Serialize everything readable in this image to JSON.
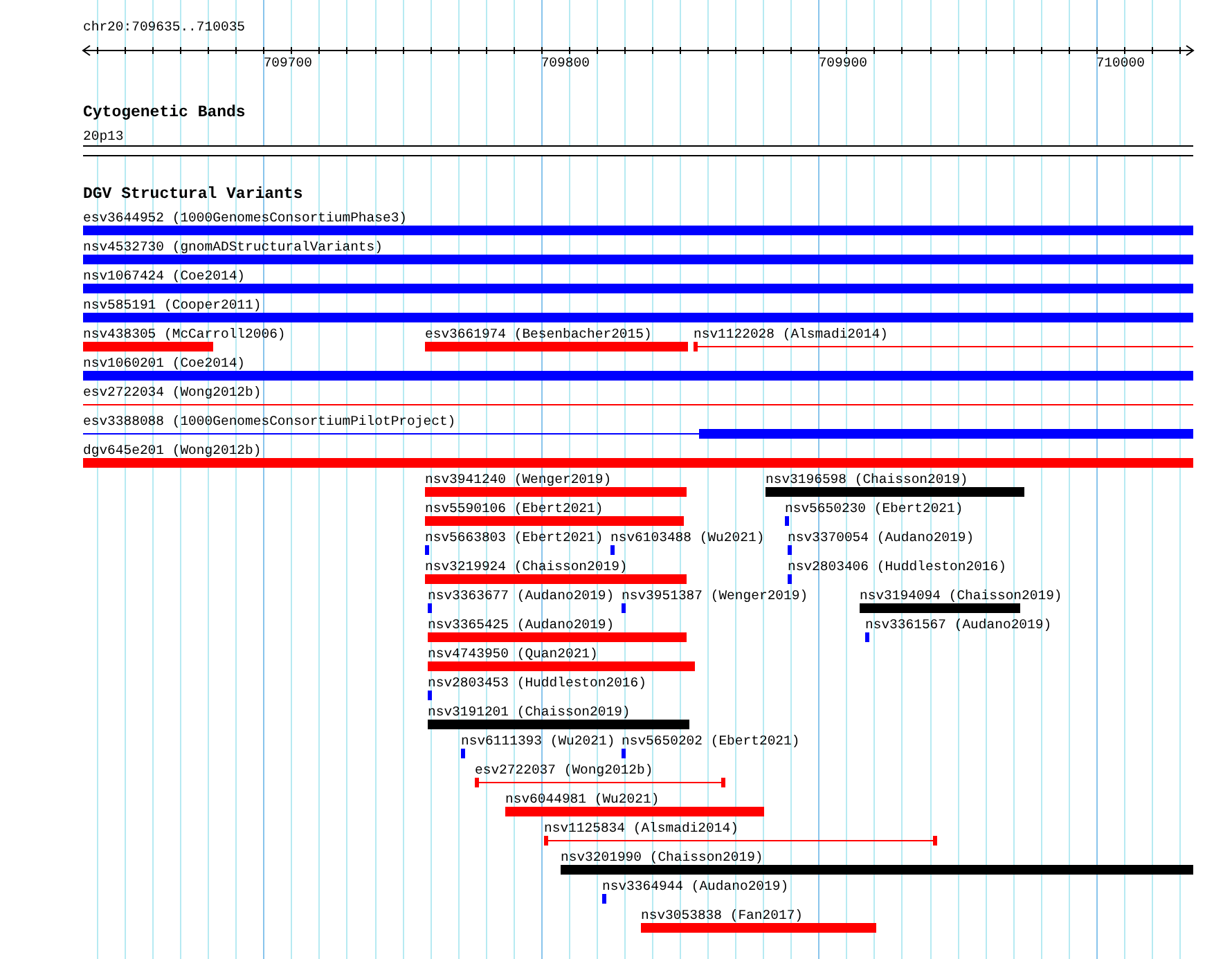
{
  "ruler": {
    "position": "chr20:709635..710035",
    "ticks": [
      {
        "label": "709700"
      },
      {
        "label": "709800"
      },
      {
        "label": "709900"
      },
      {
        "label": "710000"
      }
    ]
  },
  "cytogenetic_bands": {
    "title": "Cytogenetic Bands",
    "band": {
      "label": "20p13"
    }
  },
  "dgv_track": {
    "title": "DGV Structural Variants",
    "rows": [
      {
        "features": [
          {
            "label": "esv3644952 (1000GenomesConsortiumPhase3)",
            "color": "#0000ff",
            "segments": [
              {
                "kind": "thick"
              }
            ]
          }
        ]
      },
      {
        "features": [
          {
            "label": "nsv4532730 (gnomADStructuralVariants)",
            "color": "#0000ff",
            "segments": [
              {
                "kind": "thick"
              }
            ]
          }
        ]
      },
      {
        "features": [
          {
            "label": "nsv1067424 (Coe2014)",
            "color": "#0000ff",
            "segments": [
              {
                "kind": "thick"
              }
            ]
          }
        ]
      },
      {
        "features": [
          {
            "label": "nsv585191 (Cooper2011)",
            "color": "#0000ff",
            "segments": [
              {
                "kind": "thick"
              }
            ]
          }
        ]
      },
      {
        "features": [
          {
            "label": "nsv438305 (McCarroll2006)",
            "color": "#ff0000",
            "segments": [
              {
                "kind": "thick"
              }
            ]
          },
          {
            "label": "esv3661974 (Besenbacher2015)",
            "color": "#ff0000",
            "segments": [
              {
                "kind": "thick"
              }
            ]
          },
          {
            "label": "nsv1122028 (Alsmadi2014)",
            "color": "#ff0000",
            "segments": [
              {
                "kind": "thick"
              },
              {
                "kind": "thin"
              }
            ]
          }
        ]
      },
      {
        "features": [
          {
            "label": "nsv1060201 (Coe2014)",
            "color": "#0000ff",
            "segments": [
              {
                "kind": "thick"
              }
            ]
          }
        ]
      },
      {
        "features": [
          {
            "label": "esv2722034 (Wong2012b)",
            "color": "#ff0000",
            "segments": [
              {
                "kind": "thin"
              }
            ]
          }
        ]
      },
      {
        "features": [
          {
            "label": "esv3388088 (1000GenomesConsortiumPilotProject)",
            "color": "#0000ff",
            "segments": [
              {
                "kind": "thin"
              },
              {
                "kind": "thick"
              }
            ]
          }
        ]
      },
      {
        "features": [
          {
            "label": "dgv645e201 (Wong2012b)",
            "color": "#ff0000",
            "segments": [
              {
                "kind": "thick"
              }
            ]
          }
        ]
      },
      {
        "features": [
          {
            "label": "nsv3941240 (Wenger2019)",
            "color": "#ff0000",
            "segments": [
              {
                "kind": "thick"
              }
            ]
          },
          {
            "label": "nsv3196598 (Chaisson2019)",
            "color": "#000000",
            "segments": [
              {
                "kind": "thick"
              }
            ]
          }
        ]
      },
      {
        "features": [
          {
            "label": "nsv5590106 (Ebert2021)",
            "color": "#ff0000",
            "segments": [
              {
                "kind": "thick"
              }
            ]
          },
          {
            "label": "nsv5650230 (Ebert2021)",
            "color": "#0000ff",
            "segments": [
              {
                "kind": "thick"
              }
            ]
          }
        ]
      },
      {
        "features": [
          {
            "label": "nsv5663803 (Ebert2021)",
            "color": "#0000ff",
            "segments": [
              {
                "kind": "thick"
              }
            ]
          },
          {
            "label": "nsv6103488 (Wu2021)",
            "color": "#0000ff",
            "segments": [
              {
                "kind": "thick"
              }
            ]
          },
          {
            "label": "nsv3370054 (Audano2019)",
            "color": "#0000ff",
            "segments": [
              {
                "kind": "thick"
              }
            ]
          }
        ]
      },
      {
        "features": [
          {
            "label": "nsv3219924 (Chaisson2019)",
            "color": "#ff0000",
            "segments": [
              {
                "kind": "thick"
              }
            ]
          },
          {
            "label": "nsv2803406 (Huddleston2016)",
            "color": "#0000ff",
            "segments": [
              {
                "kind": "thick"
              }
            ]
          }
        ]
      },
      {
        "features": [
          {
            "label": "nsv3363677 (Audano2019)",
            "color": "#0000ff",
            "segments": [
              {
                "kind": "thick"
              }
            ]
          },
          {
            "label": "nsv3951387 (Wenger2019)",
            "color": "#0000ff",
            "segments": [
              {
                "kind": "thick"
              }
            ]
          },
          {
            "label": "nsv3194094 (Chaisson2019)",
            "color": "#000000",
            "segments": [
              {
                "kind": "thick"
              }
            ]
          }
        ]
      },
      {
        "features": [
          {
            "label": "nsv3365425 (Audano2019)",
            "color": "#ff0000",
            "segments": [
              {
                "kind": "thick"
              }
            ]
          },
          {
            "label": "nsv3361567 (Audano2019)",
            "color": "#0000ff",
            "segments": [
              {
                "kind": "thick"
              }
            ]
          }
        ]
      },
      {
        "features": [
          {
            "label": "nsv4743950 (Quan2021)",
            "color": "#ff0000",
            "segments": [
              {
                "kind": "thick"
              }
            ]
          }
        ]
      },
      {
        "features": [
          {
            "label": "nsv2803453 (Huddleston2016)",
            "color": "#0000ff",
            "segments": [
              {
                "kind": "thick"
              }
            ]
          }
        ]
      },
      {
        "features": [
          {
            "label": "nsv3191201 (Chaisson2019)",
            "color": "#000000",
            "segments": [
              {
                "kind": "thick"
              }
            ]
          }
        ]
      },
      {
        "features": [
          {
            "label": "nsv6111393 (Wu2021)",
            "color": "#0000ff",
            "segments": [
              {
                "kind": "thick"
              }
            ]
          },
          {
            "label": "nsv5650202 (Ebert2021)",
            "color": "#0000ff",
            "segments": [
              {
                "kind": "thick"
              }
            ]
          }
        ]
      },
      {
        "features": [
          {
            "label": "esv2722037 (Wong2012b)",
            "color": "#ff0000",
            "segments": [
              {
                "kind": "thick"
              },
              {
                "kind": "thin"
              },
              {
                "kind": "thick"
              }
            ]
          }
        ]
      },
      {
        "features": [
          {
            "label": "nsv6044981 (Wu2021)",
            "color": "#ff0000",
            "segments": [
              {
                "kind": "thick"
              }
            ]
          }
        ]
      },
      {
        "features": [
          {
            "label": "nsv1125834 (Alsmadi2014)",
            "color": "#ff0000",
            "segments": [
              {
                "kind": "thick"
              },
              {
                "kind": "thin"
              },
              {
                "kind": "thick"
              }
            ]
          }
        ]
      },
      {
        "features": [
          {
            "label": "nsv3201990 (Chaisson2019)",
            "color": "#000000",
            "segments": [
              {
                "kind": "thick"
              }
            ]
          }
        ]
      },
      {
        "features": [
          {
            "label": "nsv3364944 (Audano2019)",
            "color": "#0000ff",
            "segments": [
              {
                "kind": "thick"
              }
            ]
          }
        ]
      },
      {
        "features": [
          {
            "label": "nsv3053838 (Fan2017)",
            "color": "#ff0000",
            "segments": [
              {
                "kind": "thick"
              }
            ]
          }
        ]
      }
    ]
  }
}
